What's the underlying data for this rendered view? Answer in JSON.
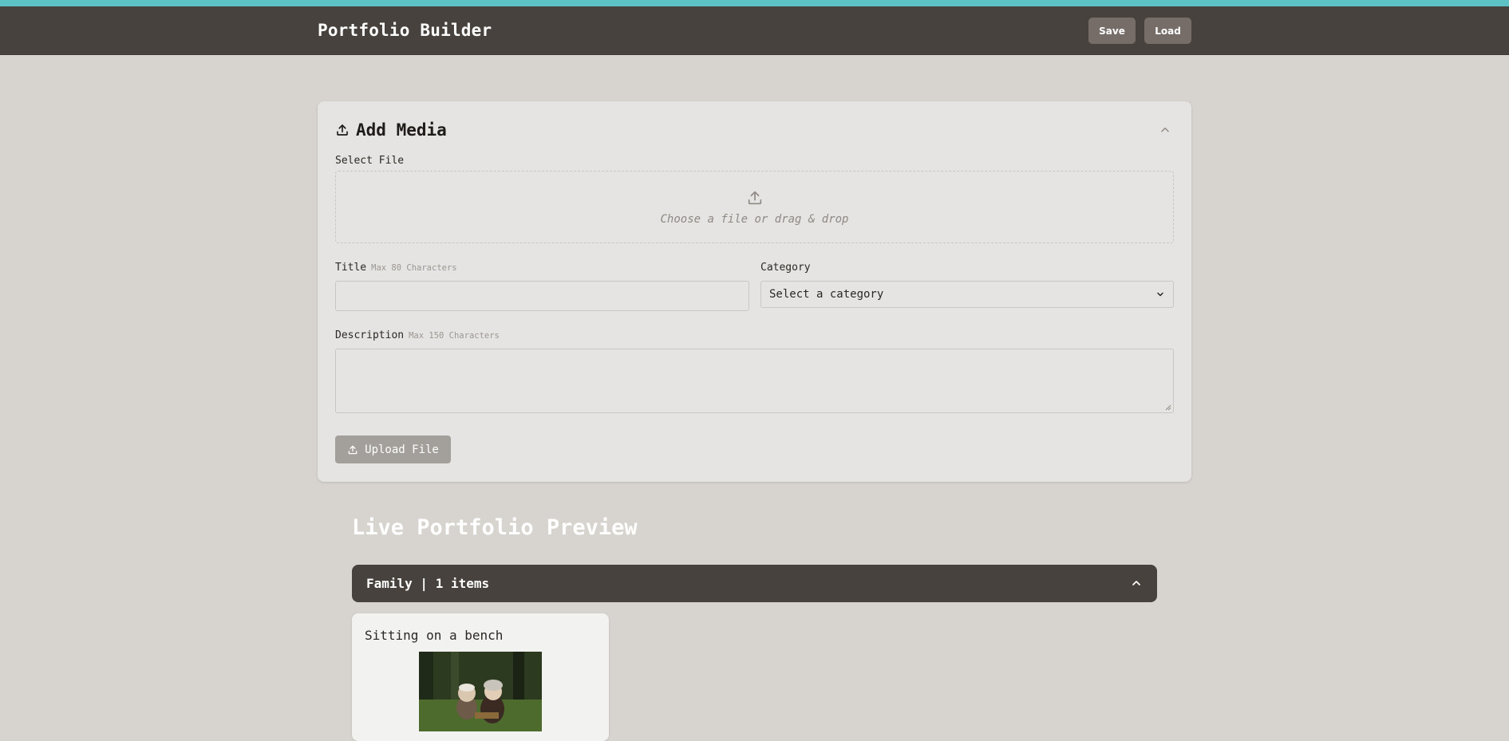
{
  "header": {
    "brand": "Portfolio Builder",
    "save_label": "Save",
    "load_label": "Load"
  },
  "add_media": {
    "title": "Add Media",
    "select_file_label": "Select File",
    "dropzone_text": "Choose a file or drag & drop",
    "title_label": "Title",
    "title_hint": "Max 80 Characters",
    "title_value": "",
    "category_label": "Category",
    "category_selected": "Select a category",
    "description_label": "Description",
    "description_hint": "Max 150 Characters",
    "description_value": "",
    "upload_button": "Upload File"
  },
  "preview": {
    "title": "Live Portfolio Preview",
    "category_bar": "Family | 1 items",
    "items": [
      {
        "title": "Sitting on a bench",
        "image": "photo-elderly-couple-on-bench"
      }
    ]
  },
  "icons": {
    "add_media": "upload-icon",
    "dropzone": "upload-icon",
    "upload_button": "upload-icon",
    "collapse": "chevron-up-icon",
    "category_chevron": "chevron-up-icon",
    "select_arrow": "chevron-down-icon"
  },
  "colors": {
    "accent_bar": "#5cc2c6",
    "header_bg": "#47423d",
    "page_bg": "#d7d3cf",
    "card_bg": "#e5e4e2",
    "header_button": "#766d69",
    "upload_button": "#a39f9b"
  }
}
